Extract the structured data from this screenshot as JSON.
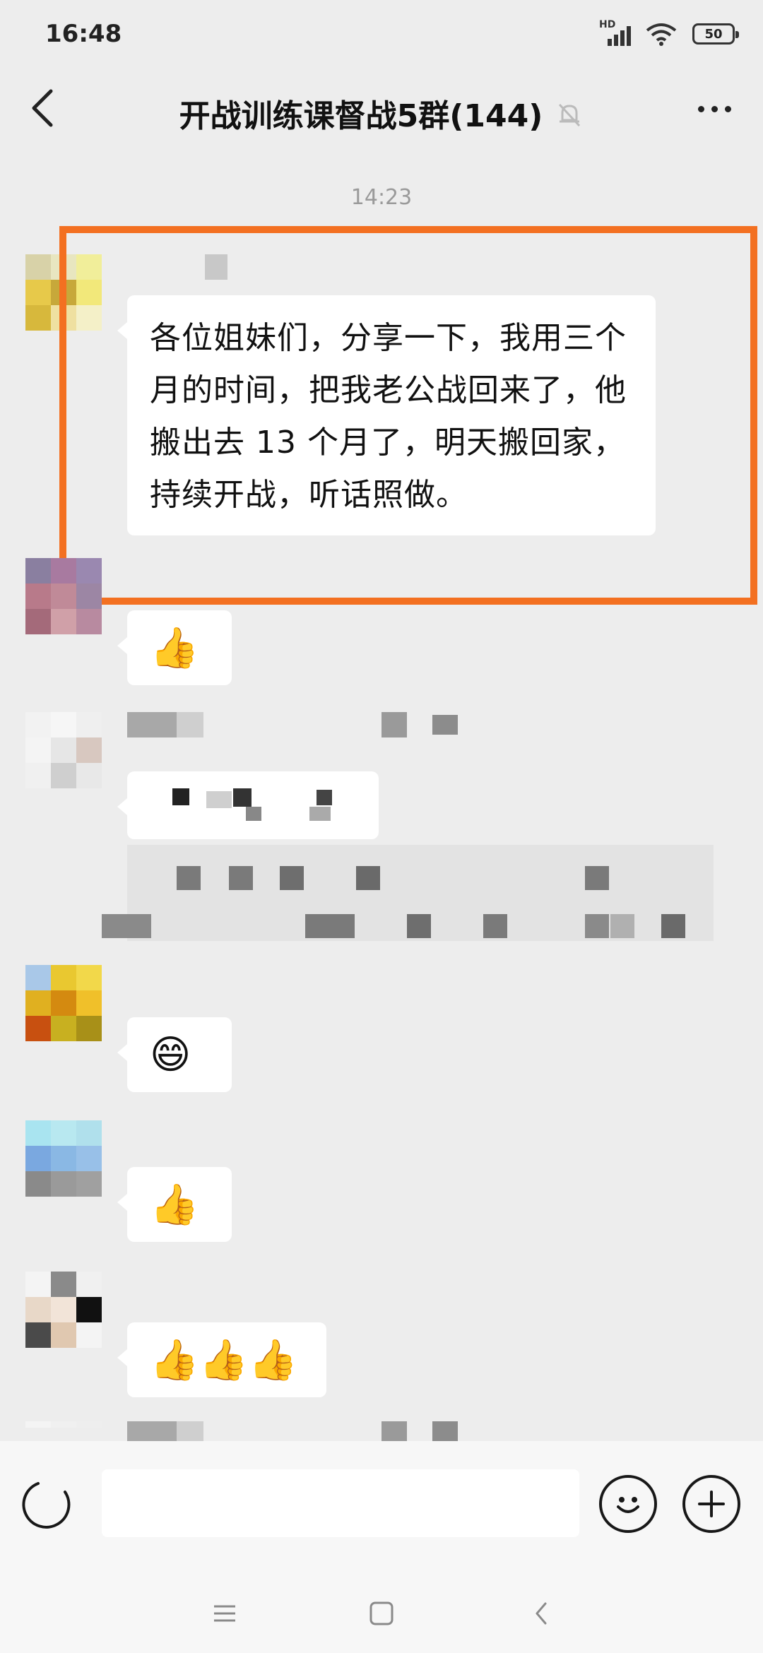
{
  "status_bar": {
    "time": "16:48",
    "network_label": "HD",
    "battery": "50"
  },
  "header": {
    "title": "开战训练课督战5群(144)",
    "icons": [
      "back-chevron-icon",
      "mute-bell-icon",
      "more-dots-icon"
    ]
  },
  "chat": {
    "timestamp": "14:23",
    "main_message": "各位姐妹们，分享一下，我用三个月的时间，把我老公战回来了，他搬出去 13 个月了，明天搬回家，持续开战，听话照做。",
    "highlight_color": "#f37021",
    "emoji_messages": [
      {
        "name": "thumbs-up",
        "glyph": "👍"
      },
      {
        "name": "grinning-face",
        "glyph": "😄"
      },
      {
        "name": "thumbs-up",
        "glyph": "👍"
      },
      {
        "name": "three-thumbs-up",
        "glyph": "👍👍👍"
      }
    ]
  },
  "input_bar": {
    "placeholder": "",
    "icons": [
      "voice-icon",
      "emoji-icon",
      "plus-icon"
    ]
  },
  "system_nav": {
    "icons": [
      "menu-icon",
      "home-square-icon",
      "back-icon"
    ]
  }
}
